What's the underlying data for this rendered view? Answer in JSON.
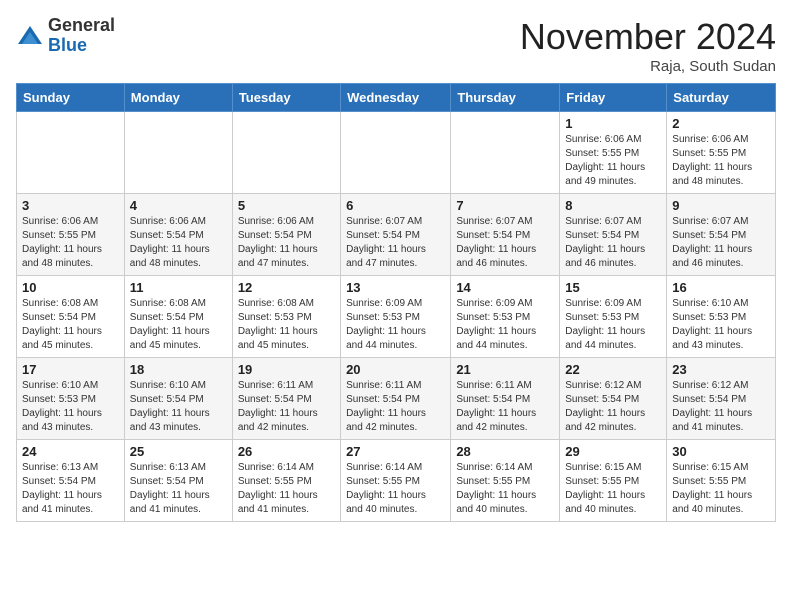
{
  "logo": {
    "general": "General",
    "blue": "Blue"
  },
  "header": {
    "month": "November 2024",
    "location": "Raja, South Sudan"
  },
  "weekdays": [
    "Sunday",
    "Monday",
    "Tuesday",
    "Wednesday",
    "Thursday",
    "Friday",
    "Saturday"
  ],
  "weeks": [
    [
      {
        "day": "",
        "info": ""
      },
      {
        "day": "",
        "info": ""
      },
      {
        "day": "",
        "info": ""
      },
      {
        "day": "",
        "info": ""
      },
      {
        "day": "",
        "info": ""
      },
      {
        "day": "1",
        "info": "Sunrise: 6:06 AM\nSunset: 5:55 PM\nDaylight: 11 hours\nand 49 minutes."
      },
      {
        "day": "2",
        "info": "Sunrise: 6:06 AM\nSunset: 5:55 PM\nDaylight: 11 hours\nand 48 minutes."
      }
    ],
    [
      {
        "day": "3",
        "info": "Sunrise: 6:06 AM\nSunset: 5:55 PM\nDaylight: 11 hours\nand 48 minutes."
      },
      {
        "day": "4",
        "info": "Sunrise: 6:06 AM\nSunset: 5:54 PM\nDaylight: 11 hours\nand 48 minutes."
      },
      {
        "day": "5",
        "info": "Sunrise: 6:06 AM\nSunset: 5:54 PM\nDaylight: 11 hours\nand 47 minutes."
      },
      {
        "day": "6",
        "info": "Sunrise: 6:07 AM\nSunset: 5:54 PM\nDaylight: 11 hours\nand 47 minutes."
      },
      {
        "day": "7",
        "info": "Sunrise: 6:07 AM\nSunset: 5:54 PM\nDaylight: 11 hours\nand 46 minutes."
      },
      {
        "day": "8",
        "info": "Sunrise: 6:07 AM\nSunset: 5:54 PM\nDaylight: 11 hours\nand 46 minutes."
      },
      {
        "day": "9",
        "info": "Sunrise: 6:07 AM\nSunset: 5:54 PM\nDaylight: 11 hours\nand 46 minutes."
      }
    ],
    [
      {
        "day": "10",
        "info": "Sunrise: 6:08 AM\nSunset: 5:54 PM\nDaylight: 11 hours\nand 45 minutes."
      },
      {
        "day": "11",
        "info": "Sunrise: 6:08 AM\nSunset: 5:54 PM\nDaylight: 11 hours\nand 45 minutes."
      },
      {
        "day": "12",
        "info": "Sunrise: 6:08 AM\nSunset: 5:53 PM\nDaylight: 11 hours\nand 45 minutes."
      },
      {
        "day": "13",
        "info": "Sunrise: 6:09 AM\nSunset: 5:53 PM\nDaylight: 11 hours\nand 44 minutes."
      },
      {
        "day": "14",
        "info": "Sunrise: 6:09 AM\nSunset: 5:53 PM\nDaylight: 11 hours\nand 44 minutes."
      },
      {
        "day": "15",
        "info": "Sunrise: 6:09 AM\nSunset: 5:53 PM\nDaylight: 11 hours\nand 44 minutes."
      },
      {
        "day": "16",
        "info": "Sunrise: 6:10 AM\nSunset: 5:53 PM\nDaylight: 11 hours\nand 43 minutes."
      }
    ],
    [
      {
        "day": "17",
        "info": "Sunrise: 6:10 AM\nSunset: 5:53 PM\nDaylight: 11 hours\nand 43 minutes."
      },
      {
        "day": "18",
        "info": "Sunrise: 6:10 AM\nSunset: 5:54 PM\nDaylight: 11 hours\nand 43 minutes."
      },
      {
        "day": "19",
        "info": "Sunrise: 6:11 AM\nSunset: 5:54 PM\nDaylight: 11 hours\nand 42 minutes."
      },
      {
        "day": "20",
        "info": "Sunrise: 6:11 AM\nSunset: 5:54 PM\nDaylight: 11 hours\nand 42 minutes."
      },
      {
        "day": "21",
        "info": "Sunrise: 6:11 AM\nSunset: 5:54 PM\nDaylight: 11 hours\nand 42 minutes."
      },
      {
        "day": "22",
        "info": "Sunrise: 6:12 AM\nSunset: 5:54 PM\nDaylight: 11 hours\nand 42 minutes."
      },
      {
        "day": "23",
        "info": "Sunrise: 6:12 AM\nSunset: 5:54 PM\nDaylight: 11 hours\nand 41 minutes."
      }
    ],
    [
      {
        "day": "24",
        "info": "Sunrise: 6:13 AM\nSunset: 5:54 PM\nDaylight: 11 hours\nand 41 minutes."
      },
      {
        "day": "25",
        "info": "Sunrise: 6:13 AM\nSunset: 5:54 PM\nDaylight: 11 hours\nand 41 minutes."
      },
      {
        "day": "26",
        "info": "Sunrise: 6:14 AM\nSunset: 5:55 PM\nDaylight: 11 hours\nand 41 minutes."
      },
      {
        "day": "27",
        "info": "Sunrise: 6:14 AM\nSunset: 5:55 PM\nDaylight: 11 hours\nand 40 minutes."
      },
      {
        "day": "28",
        "info": "Sunrise: 6:14 AM\nSunset: 5:55 PM\nDaylight: 11 hours\nand 40 minutes."
      },
      {
        "day": "29",
        "info": "Sunrise: 6:15 AM\nSunset: 5:55 PM\nDaylight: 11 hours\nand 40 minutes."
      },
      {
        "day": "30",
        "info": "Sunrise: 6:15 AM\nSunset: 5:55 PM\nDaylight: 11 hours\nand 40 minutes."
      }
    ]
  ]
}
